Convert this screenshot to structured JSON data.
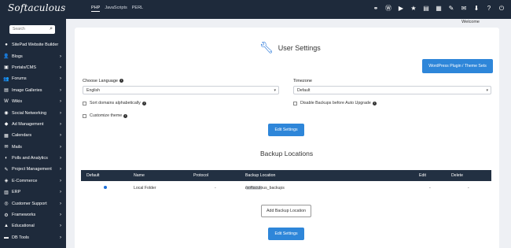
{
  "header": {
    "logo": "Softaculous",
    "tabs": [
      "PHP",
      "JavaScripts",
      "PERL"
    ],
    "active_tab": "PHP",
    "icons": [
      "cpanel-icon",
      "wordpress-icon",
      "play-icon",
      "star-icon",
      "list-icon",
      "table-icon",
      "wrench-icon",
      "envelope-icon",
      "download-icon",
      "help-icon",
      "power-icon"
    ]
  },
  "welcome": "Welcome",
  "sidebar": {
    "search_placeholder": "Search",
    "items": [
      {
        "label": "SitePad Website Builder",
        "icon": "●",
        "chevron": ""
      },
      {
        "label": "Blogs",
        "icon": "👤",
        "chevron": "›"
      },
      {
        "label": "Portals/CMS",
        "icon": "▣",
        "chevron": "›"
      },
      {
        "label": "Forums",
        "icon": "👥",
        "chevron": "›"
      },
      {
        "label": "Image Galleries",
        "icon": "▤",
        "chevron": "›"
      },
      {
        "label": "Wikis",
        "icon": "W",
        "chevron": "›"
      },
      {
        "label": "Social Networking",
        "icon": "◉",
        "chevron": "›"
      },
      {
        "label": "Ad Management",
        "icon": "◆",
        "chevron": "›"
      },
      {
        "label": "Calendars",
        "icon": "▦",
        "chevron": "›"
      },
      {
        "label": "Mails",
        "icon": "✉",
        "chevron": "›"
      },
      {
        "label": "Polls and Analytics",
        "icon": "◐",
        "chevron": "›"
      },
      {
        "label": "Project Management",
        "icon": "✎",
        "chevron": "›"
      },
      {
        "label": "E-Commerce",
        "icon": "◈",
        "chevron": "›"
      },
      {
        "label": "ERP",
        "icon": "▥",
        "chevron": "›"
      },
      {
        "label": "Customer Support",
        "icon": "◎",
        "chevron": "›"
      },
      {
        "label": "Frameworks",
        "icon": "⚙",
        "chevron": "›"
      },
      {
        "label": "Educational",
        "icon": "▲",
        "chevron": "›"
      },
      {
        "label": "DB Tools",
        "icon": "▬",
        "chevron": "›"
      }
    ]
  },
  "settings": {
    "title": "User Settings",
    "wp_button": "WordPress Plugin / Theme Sets",
    "language_label": "Choose Language",
    "language_value": "English",
    "timezone_label": "Timezone",
    "timezone_value": "Default",
    "sort_label": "Sort domains alphabetically",
    "disable_backups_label": "Disable Backups before Auto Upgrade",
    "customize_label": "Customize theme",
    "edit_button": "Edit Settings"
  },
  "backup": {
    "title": "Backup Locations",
    "columns": [
      "Default",
      "Name",
      "Protocol",
      "Backup Location",
      "Edit",
      "Delete"
    ],
    "row": {
      "name": "Local Folder",
      "protocol": "-",
      "location_prefix": "/home/",
      "location_suffix": "/softaculous_backups",
      "edit": "-",
      "delete": "-"
    },
    "add_button": "Add Backup Location",
    "edit_button": "Edit Settings"
  }
}
